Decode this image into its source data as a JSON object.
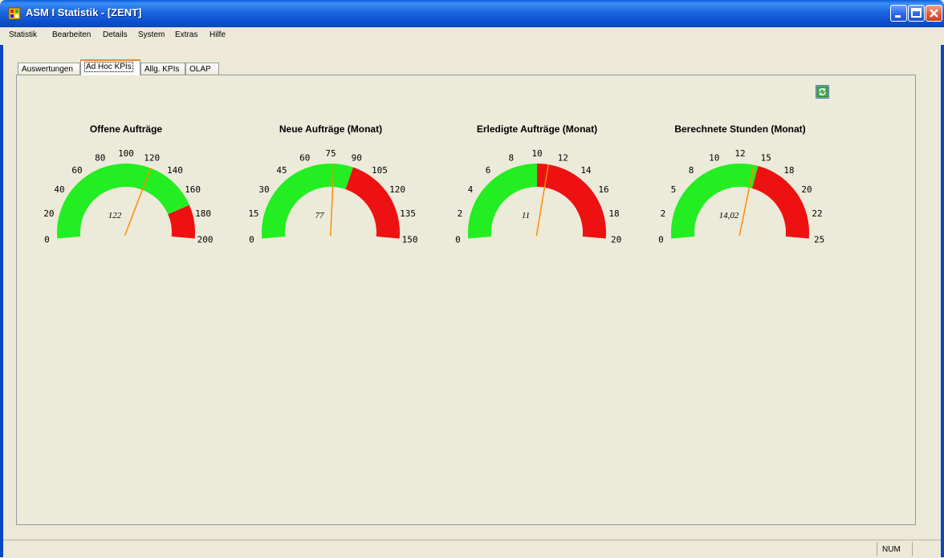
{
  "window": {
    "title": "ASM I Statistik - [ZENT]"
  },
  "menu": [
    "Statistik",
    "Bearbeiten",
    "Details",
    "System",
    "Extras",
    "Hilfe"
  ],
  "tabs": [
    "Auswertungen",
    "Ad Hoc KPIs",
    "Allg. KPIs",
    "OLAP"
  ],
  "active_tab": 1,
  "colors": {
    "green": "#22ee22",
    "red": "#ee1111",
    "needle": "#ff8c00"
  },
  "gauges": [
    {
      "title": "Offene Aufträge",
      "min": 0,
      "max": 200,
      "ticks": [
        "0",
        "20",
        "40",
        "60",
        "80",
        "100",
        "120",
        "140",
        "160",
        "180",
        "200"
      ],
      "value": 122,
      "value_label": "122",
      "green_to": 170
    },
    {
      "title": "Neue Aufträge (Monat)",
      "min": 0,
      "max": 150,
      "ticks": [
        "0",
        "15",
        "30",
        "45",
        "60",
        "75",
        "90",
        "105",
        "120",
        "135",
        "150"
      ],
      "value": 77,
      "value_label": "77",
      "green_to": 90
    },
    {
      "title": "Erledigte Aufträge (Monat)",
      "min": 0,
      "max": 20,
      "ticks": [
        "0",
        "2",
        "4",
        "6",
        "8",
        "10",
        "12",
        "14",
        "16",
        "18",
        "20"
      ],
      "value": 11,
      "value_label": "11",
      "green_to": 10
    },
    {
      "title": "Berechnete Stunden (Monat)",
      "min": 0,
      "max": 25,
      "ticks": [
        "0",
        "2",
        "5",
        "8",
        "10",
        "12",
        "15",
        "18",
        "20",
        "22",
        "25"
      ],
      "value": 14.02,
      "value_label": "14,02",
      "green_to": 14.5
    }
  ],
  "status": {
    "num": "NUM"
  }
}
